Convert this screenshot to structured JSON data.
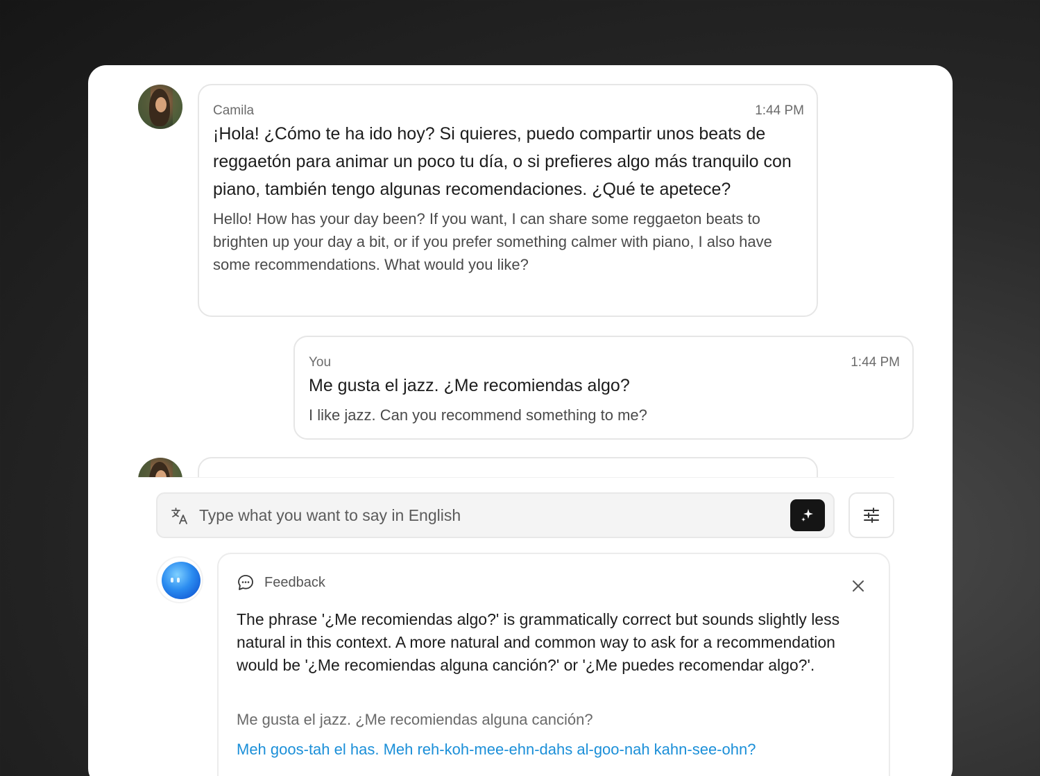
{
  "messages": [
    {
      "sender": "Camila",
      "time": "1:44 PM",
      "text": "¡Hola! ¿Cómo te ha ido hoy? Si quieres, puedo compartir unos beats de reggaetón para animar un poco tu día, o si prefieres algo más tranquilo con piano, también tengo algunas recomendaciones. ¿Qué te apetece?",
      "translation": "Hello! How has your day been? If you want, I can share some reggaeton beats to brighten up your day a bit, or if you prefer something calmer with piano, I also have some recommendations. What would you like?"
    },
    {
      "sender": "You",
      "time": "1:44 PM",
      "text": "Me gusta el jazz. ¿Me recomiendas algo?",
      "translation": "I like jazz. Can you recommend something to me?"
    }
  ],
  "composer": {
    "placeholder": "Type what you want to say in English"
  },
  "feedback": {
    "title": "Feedback",
    "body": "The phrase '¿Me recomiendas algo?' is grammatically correct but sounds slightly less natural in this context. A more natural and common way to ask for a recommendation would be '¿Me recomiendas alguna canción?' or '¿Me puedes recomendar algo?'.",
    "suggestion": "Me gusta el jazz. ¿Me recomiendas alguna canción?",
    "pronunciation": "Meh goos-tah el has. Meh reh-koh-mee-ehn-dahs al-goo-nah kahn-see-ohn?"
  },
  "icons": {
    "translate": "translate-icon",
    "magic": "sparkle-icon",
    "settings": "sliders-icon",
    "feedback": "chat-bubble-icon",
    "close": "close-icon"
  },
  "colors": {
    "pronunciation": "#1b8fd8",
    "send_button": "#151515",
    "bot_orb": "#2b8cf0"
  }
}
